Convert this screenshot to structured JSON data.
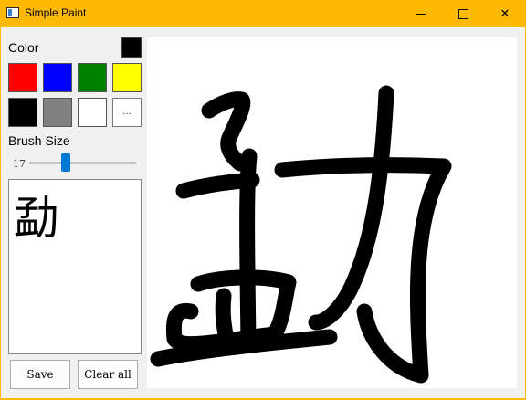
{
  "window": {
    "title": "Simple Paint"
  },
  "controls": {
    "minimize_icon": "minimize-icon",
    "maximize_icon": "maximize-icon",
    "close_icon": "close-icon",
    "close_glyph": "✕"
  },
  "color": {
    "label": "Color",
    "current": "#000000",
    "more_label": "..."
  },
  "palette": [
    "#ff0000",
    "#0000ff",
    "#008000",
    "#ffff00",
    "#000000",
    "#808080",
    "#ffffff"
  ],
  "brush": {
    "label": "Brush Size",
    "value": "17",
    "min": 1,
    "max": 50
  },
  "preview": {
    "text": "勐"
  },
  "buttons": {
    "save_label": "Save",
    "clear_label": "Clear all"
  },
  "accent": "#0078d7",
  "titlebar_color": "#ffb900"
}
